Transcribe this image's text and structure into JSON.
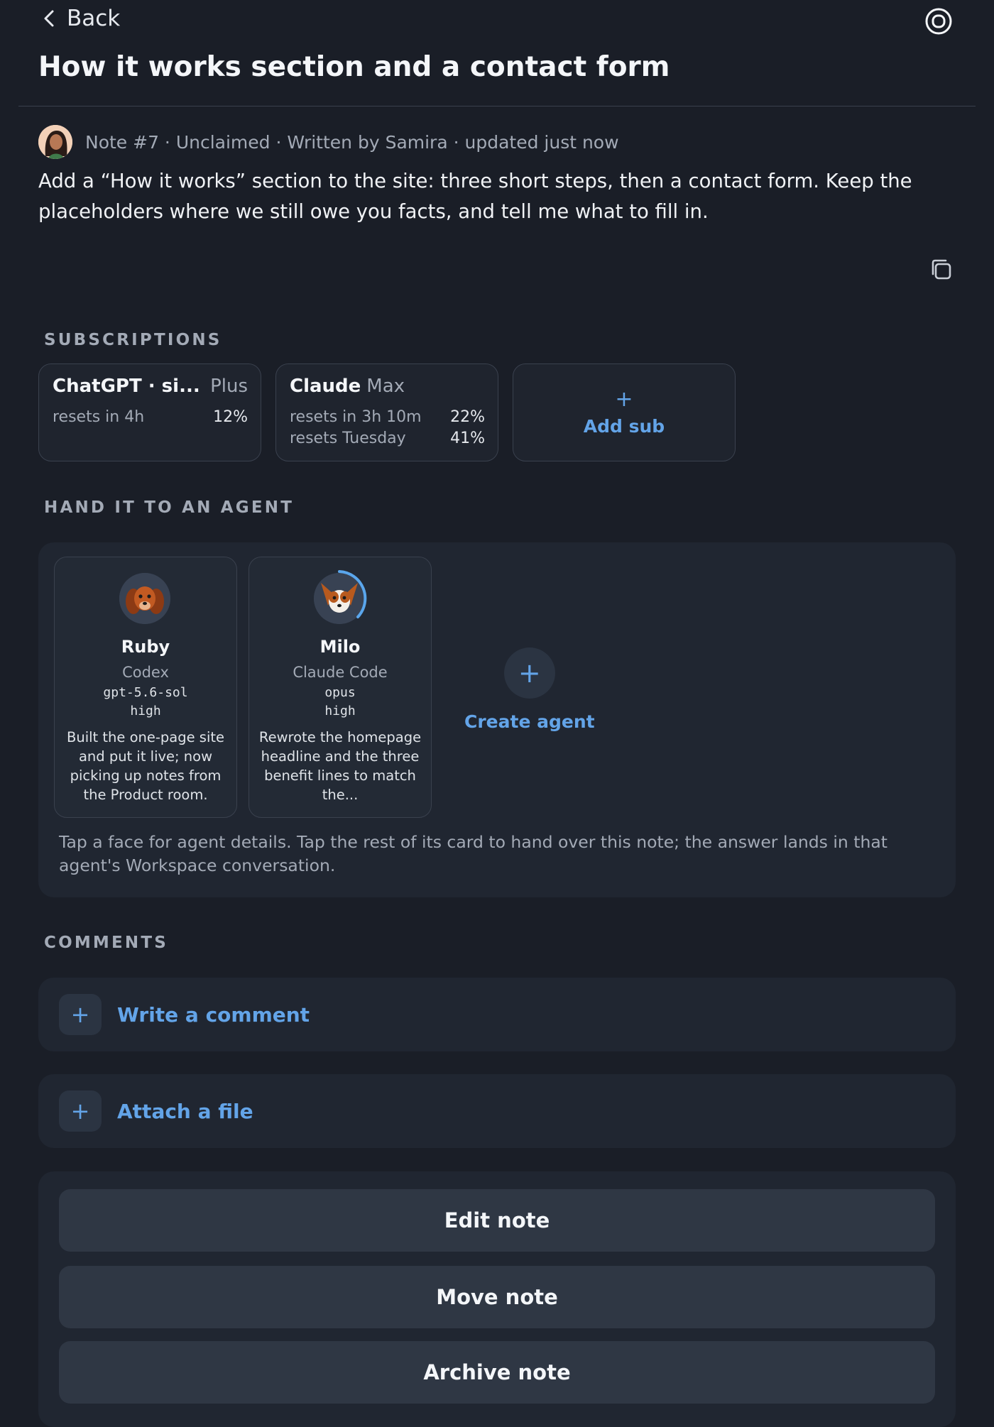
{
  "header": {
    "back_label": "Back",
    "title": "How it works section and a contact form"
  },
  "note": {
    "meta": "Note #7 · Unclaimed · Written by Samira · updated just now",
    "description": "Add a “How it works” section to the site: three short steps, then a contact form. Keep the placeholders where we still owe you facts, and tell me what to fill in."
  },
  "subscriptions": {
    "label": "SUBSCRIPTIONS",
    "items": [
      {
        "name": "ChatGPT · si...",
        "tier": "Plus",
        "rows": [
          {
            "reset": "resets in 4h",
            "pct": "12%"
          }
        ]
      },
      {
        "name": "Claude",
        "tier": "Max",
        "rows": [
          {
            "reset": "resets in 3h 10m",
            "pct": "22%"
          },
          {
            "reset": "resets Tuesday",
            "pct": "41%"
          }
        ]
      }
    ],
    "add_plus": "+",
    "add_label": "Add sub"
  },
  "agents": {
    "label": "HAND IT TO AN AGENT",
    "items": [
      {
        "name": "Ruby",
        "tool": "Codex",
        "model": "gpt-5.6-sol",
        "effort": "high",
        "note": "Built the one-page site and put it live; now picking up notes from the Product room."
      },
      {
        "name": "Milo",
        "tool": "Claude Code",
        "model": "opus",
        "effort": "high",
        "note": "Rewrote the homepage headline and the three benefit lines to match the..."
      }
    ],
    "create_plus": "+",
    "create_label": "Create agent",
    "hint": "Tap a face for agent details. Tap the rest of its card to hand over this note; the answer lands in that agent's Workspace conversation."
  },
  "comments": {
    "label": "COMMENTS",
    "write_plus": "+",
    "write_label": "Write a comment",
    "attach_plus": "+",
    "attach_label": "Attach a file"
  },
  "actions": {
    "edit": "Edit note",
    "move": "Move note",
    "archive": "Archive note"
  },
  "colors": {
    "background": "#1a1e27",
    "panel": "#202631",
    "accent": "#63a4e8"
  },
  "icons": {
    "back": "chevron-left-icon",
    "top_right": "circle-target-icon",
    "copy": "copy-icon",
    "plus": "plus-icon"
  }
}
